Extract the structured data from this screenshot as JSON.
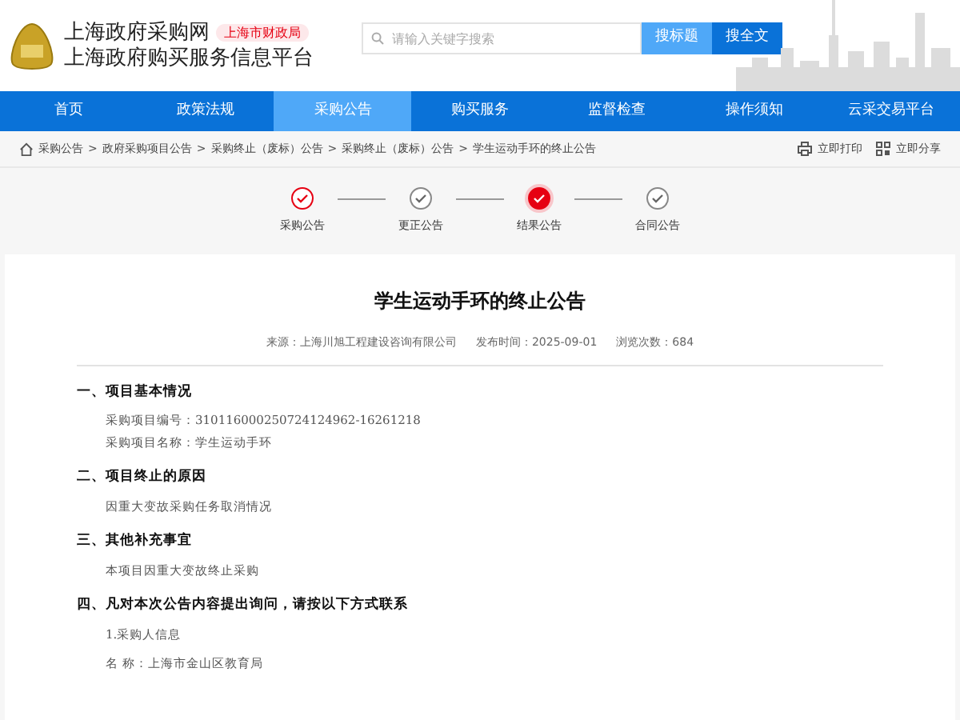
{
  "header": {
    "site_name": "上海政府采购网",
    "badge": "上海市财政局",
    "platform_name": "上海政府购买服务信息平台"
  },
  "search": {
    "placeholder": "请输入关键字搜索",
    "buttons": [
      {
        "label": "搜标题",
        "selected": true
      },
      {
        "label": "搜全文",
        "selected": false
      }
    ]
  },
  "nav": [
    {
      "label": "首页",
      "selected": false
    },
    {
      "label": "政策法规",
      "selected": false
    },
    {
      "label": "采购公告",
      "selected": true
    },
    {
      "label": "购买服务",
      "selected": false
    },
    {
      "label": "监督检查",
      "selected": false
    },
    {
      "label": "操作须知",
      "selected": false
    },
    {
      "label": "云采交易平台",
      "selected": false
    }
  ],
  "breadcrumb": {
    "separator": ">",
    "items": [
      "采购公告",
      "政府采购项目公告",
      "采购终止（废标）公告",
      "采购终止（废标）公告",
      "学生运动手环的终止公告"
    ]
  },
  "actions": [
    {
      "kind": "print",
      "label": "立即打印"
    },
    {
      "kind": "share",
      "label": "立即分享"
    }
  ],
  "steps": [
    {
      "label": "采购公告",
      "kind": "done"
    },
    {
      "label": "更正公告",
      "kind": "pending"
    },
    {
      "label": "结果公告",
      "kind": "current"
    },
    {
      "label": "合同公告",
      "kind": "pending"
    }
  ],
  "article": {
    "title": "学生运动手环的终止公告",
    "meta": [
      "来源：上海川旭工程建设咨询有限公司",
      "发布时间：2025-09-01",
      "浏览次数：684"
    ],
    "sections": [
      {
        "heading": "一、项目基本情况",
        "lines": [
          "采购项目编号：310116000250724124962-16261218",
          "采购项目名称：学生运动手环"
        ]
      },
      {
        "heading": "二、项目终止的原因",
        "lines": [
          "因重大变故采购任务取消情况"
        ]
      },
      {
        "heading": "三、其他补充事宜",
        "lines": [
          "本项目因重大变故终止采购"
        ]
      },
      {
        "heading": "四、凡对本次公告内容提出询问，请按以下方式联系",
        "lines": [
          "1.采购人信息",
          "名 称：上海市金山区教育局"
        ]
      }
    ]
  }
}
